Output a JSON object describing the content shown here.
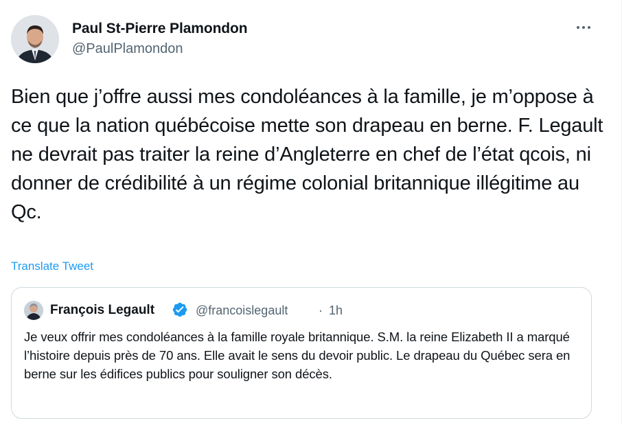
{
  "tweet": {
    "author": {
      "name": "Paul St-Pierre Plamondon",
      "handle": "@PaulPlamondon"
    },
    "text": "Bien que j’offre aussi mes condoléances à la famille, je m’oppose à ce que la nation québécoise mette son drapeau en berne. F. Legault ne devrait pas traiter la reine d’Angleterre en chef de l’état qcois, ni donner de crédibilité à un régime colonial britannique illégitime au Qc.",
    "translate_label": "Translate Tweet",
    "more_icon": "more-horizontal-icon"
  },
  "quoted_tweet": {
    "author": {
      "name": "François Legault",
      "handle": "@francoislegault",
      "verified": true
    },
    "separator": "·",
    "time": "1h",
    "text": "Je veux offrir mes condoléances à la famille royale britannique. S.M. la reine Elizabeth II a marqué l’histoire depuis près de 70 ans. Elle avait le sens du devoir public. Le drapeau du Québec sera en berne sur les édifices publics pour souligner son décès."
  },
  "colors": {
    "text": "#0f1419",
    "secondary": "#536471",
    "link": "#1d9bf0",
    "verified": "#1d9bf0",
    "card_border": "#cfd9de"
  }
}
